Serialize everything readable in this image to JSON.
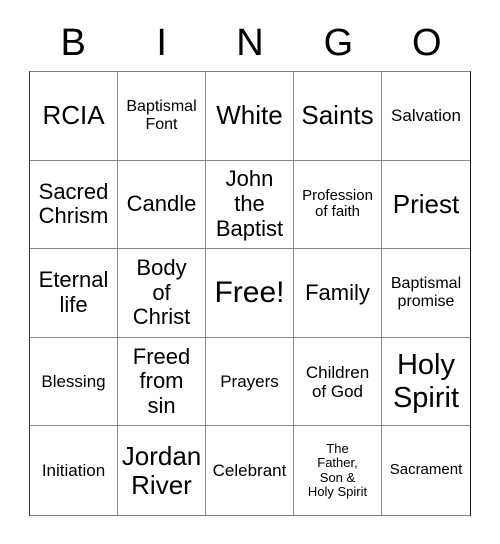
{
  "card": {
    "title": "BINGO",
    "header_letters": [
      "B",
      "I",
      "N",
      "G",
      "O"
    ],
    "free_space": "Free!",
    "rows": [
      [
        {
          "text": "RCIA",
          "size": "fs-xl"
        },
        {
          "text": "Baptismal\nFont",
          "size": "fs-sm2"
        },
        {
          "text": "White",
          "size": "fs-xl"
        },
        {
          "text": "Saints",
          "size": "fs-xl"
        },
        {
          "text": "Salvation",
          "size": "fs-md"
        }
      ],
      [
        {
          "text": "Sacred\nChrism",
          "size": "fs-lg"
        },
        {
          "text": "Candle",
          "size": "fs-lg"
        },
        {
          "text": "John\nthe\nBaptist",
          "size": "fs-lg"
        },
        {
          "text": "Profession\nof faith",
          "size": "fs-sm"
        },
        {
          "text": "Priest",
          "size": "fs-xl"
        }
      ],
      [
        {
          "text": "Eternal\nlife",
          "size": "fs-lg"
        },
        {
          "text": "Body\nof\nChrist",
          "size": "fs-lg"
        },
        {
          "text": "Free!",
          "size": "fs-free"
        },
        {
          "text": "Family",
          "size": "fs-lg"
        },
        {
          "text": "Baptismal\npromise",
          "size": "fs-sm2"
        }
      ],
      [
        {
          "text": "Blessing",
          "size": "fs-md"
        },
        {
          "text": "Freed\nfrom\nsin",
          "size": "fs-lg"
        },
        {
          "text": "Prayers",
          "size": "fs-md"
        },
        {
          "text": "Children\nof God",
          "size": "fs-md"
        },
        {
          "text": "Holy\nSpirit",
          "size": "fs-xxl"
        }
      ],
      [
        {
          "text": "Initiation",
          "size": "fs-md"
        },
        {
          "text": "Jordan\nRiver",
          "size": "fs-xl"
        },
        {
          "text": "Celebrant",
          "size": "fs-md"
        },
        {
          "text": "The\nFather,\nSon &\nHoly Spirit",
          "size": "fs-xs"
        },
        {
          "text": "Sacrament",
          "size": "fs-sm"
        }
      ]
    ]
  },
  "colors": {
    "background": "#ffffff",
    "text": "#000000",
    "grid_line": "#8a8a8a",
    "grid_border": "#3a3a3a"
  }
}
